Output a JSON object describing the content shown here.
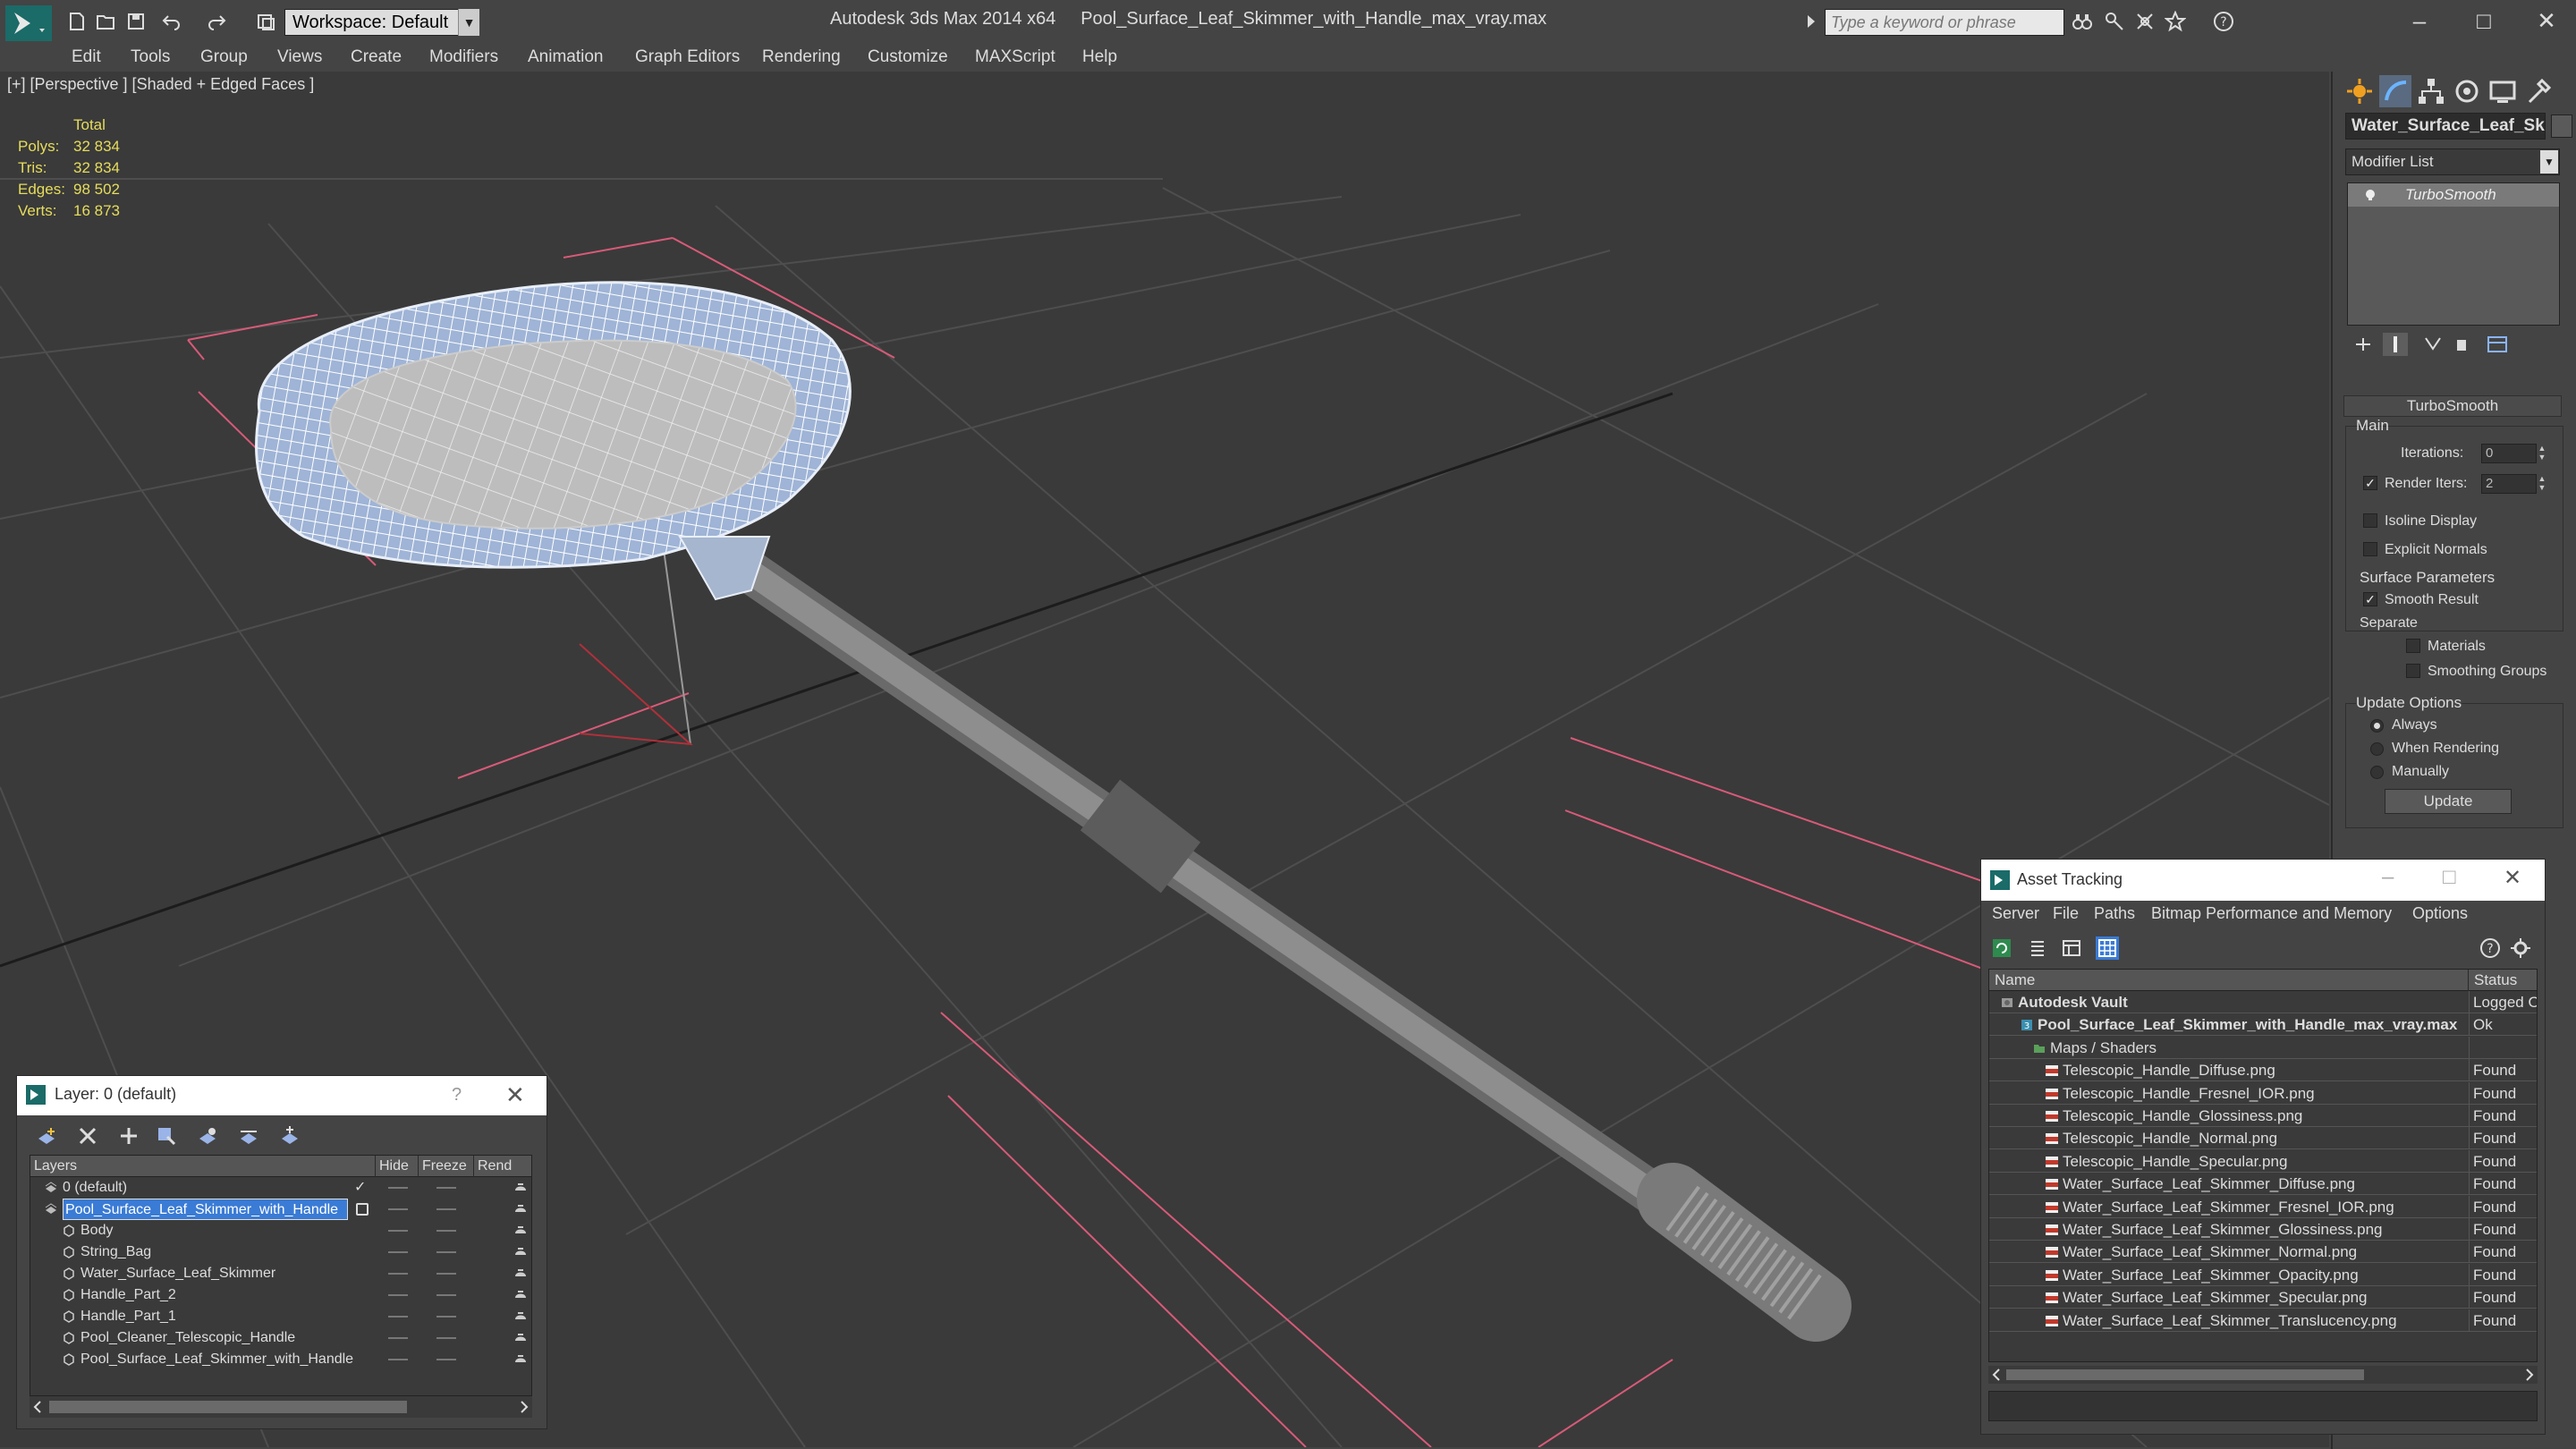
{
  "app": {
    "title": "Autodesk 3ds Max  2014 x64",
    "file": "Pool_Surface_Leaf_Skimmer_with_Handle_max_vray.max",
    "workspace": "Workspace: Default",
    "search_placeholder": "Type a keyword or phrase"
  },
  "menu": [
    "Edit",
    "Tools",
    "Group",
    "Views",
    "Create",
    "Modifiers",
    "Animation",
    "Graph Editors",
    "Rendering",
    "Customize",
    "MAXScript",
    "Help"
  ],
  "viewport": {
    "label": "[+] [Perspective ] [Shaded + Edged Faces ]",
    "stats": {
      "header": "Total",
      "rows": [
        {
          "label": "Polys:",
          "value": "32 834"
        },
        {
          "label": "Tris:",
          "value": "32 834"
        },
        {
          "label": "Edges:",
          "value": "98 502"
        },
        {
          "label": "Verts:",
          "value": "16 873"
        }
      ]
    }
  },
  "command_panel": {
    "object_name": "Water_Surface_Leaf_Skimmer",
    "modifier_list": "Modifier List",
    "stack_item": "TurboSmooth",
    "rollout": "TurboSmooth",
    "main": {
      "group": "Main",
      "iterations_label": "Iterations:",
      "iterations": "0",
      "render_iters_label": "Render Iters:",
      "render_iters": "2",
      "render_iters_checked": true,
      "isoline": "Isoline Display",
      "explicit_normals": "Explicit Normals"
    },
    "surface": {
      "group": "Surface Parameters",
      "smooth_result": "Smooth Result",
      "separate": "Separate",
      "materials": "Materials",
      "smoothing_groups": "Smoothing Groups"
    },
    "update": {
      "group": "Update Options",
      "always": "Always",
      "when_rendering": "When Rendering",
      "manually": "Manually",
      "button": "Update"
    }
  },
  "layer_window": {
    "title": "Layer: 0 (default)",
    "help": "?",
    "columns": [
      "Layers",
      "Hide",
      "Freeze",
      "Rend"
    ],
    "rows": [
      {
        "name": "0 (default)",
        "level": 1,
        "type": "layer",
        "selected": false
      },
      {
        "name": "Pool_Surface_Leaf_Skimmer_with_Handle",
        "level": 1,
        "type": "layer",
        "selected": true
      },
      {
        "name": "Body",
        "level": 2,
        "type": "object",
        "selected": false
      },
      {
        "name": "String_Bag",
        "level": 2,
        "type": "object",
        "selected": false
      },
      {
        "name": "Water_Surface_Leaf_Skimmer",
        "level": 2,
        "type": "object",
        "selected": false
      },
      {
        "name": "Handle_Part_2",
        "level": 2,
        "type": "object",
        "selected": false
      },
      {
        "name": "Handle_Part_1",
        "level": 2,
        "type": "object",
        "selected": false
      },
      {
        "name": "Pool_Cleaner_Telescopic_Handle",
        "level": 2,
        "type": "object",
        "selected": false
      },
      {
        "name": "Pool_Surface_Leaf_Skimmer_with_Handle",
        "level": 2,
        "type": "object",
        "selected": false
      }
    ]
  },
  "asset_window": {
    "title": "Asset Tracking",
    "menu": [
      "Server",
      "File",
      "Paths",
      "Bitmap Performance and Memory",
      "Options"
    ],
    "columns": [
      "Name",
      "Status"
    ],
    "rows": [
      {
        "name": "Autodesk Vault",
        "status": "Logged O",
        "level": 0,
        "icon": "vault"
      },
      {
        "name": "Pool_Surface_Leaf_Skimmer_with_Handle_max_vray.max",
        "status": "Ok",
        "level": 1,
        "icon": "max"
      },
      {
        "name": "Maps / Shaders",
        "status": "",
        "level": 2,
        "icon": "maps"
      },
      {
        "name": "Telescopic_Handle_Diffuse.png",
        "status": "Found",
        "level": 3,
        "icon": "png"
      },
      {
        "name": "Telescopic_Handle_Fresnel_IOR.png",
        "status": "Found",
        "level": 3,
        "icon": "png"
      },
      {
        "name": "Telescopic_Handle_Glossiness.png",
        "status": "Found",
        "level": 3,
        "icon": "png"
      },
      {
        "name": "Telescopic_Handle_Normal.png",
        "status": "Found",
        "level": 3,
        "icon": "png"
      },
      {
        "name": "Telescopic_Handle_Specular.png",
        "status": "Found",
        "level": 3,
        "icon": "png"
      },
      {
        "name": "Water_Surface_Leaf_Skimmer_Diffuse.png",
        "status": "Found",
        "level": 3,
        "icon": "png"
      },
      {
        "name": "Water_Surface_Leaf_Skimmer_Fresnel_IOR.png",
        "status": "Found",
        "level": 3,
        "icon": "png"
      },
      {
        "name": "Water_Surface_Leaf_Skimmer_Glossiness.png",
        "status": "Found",
        "level": 3,
        "icon": "png"
      },
      {
        "name": "Water_Surface_Leaf_Skimmer_Normal.png",
        "status": "Found",
        "level": 3,
        "icon": "png"
      },
      {
        "name": "Water_Surface_Leaf_Skimmer_Opacity.png",
        "status": "Found",
        "level": 3,
        "icon": "png"
      },
      {
        "name": "Water_Surface_Leaf_Skimmer_Specular.png",
        "status": "Found",
        "level": 3,
        "icon": "png"
      },
      {
        "name": "Water_Surface_Leaf_Skimmer_Translucency.png",
        "status": "Found",
        "level": 3,
        "icon": "png"
      }
    ]
  },
  "colors": {
    "stats_text": "#e6dc5c",
    "selection": "#3a7bd5",
    "viewport_bg": "#3a3a3a",
    "grid": "#4e4e4e",
    "bbox_red": "#d85a78"
  }
}
